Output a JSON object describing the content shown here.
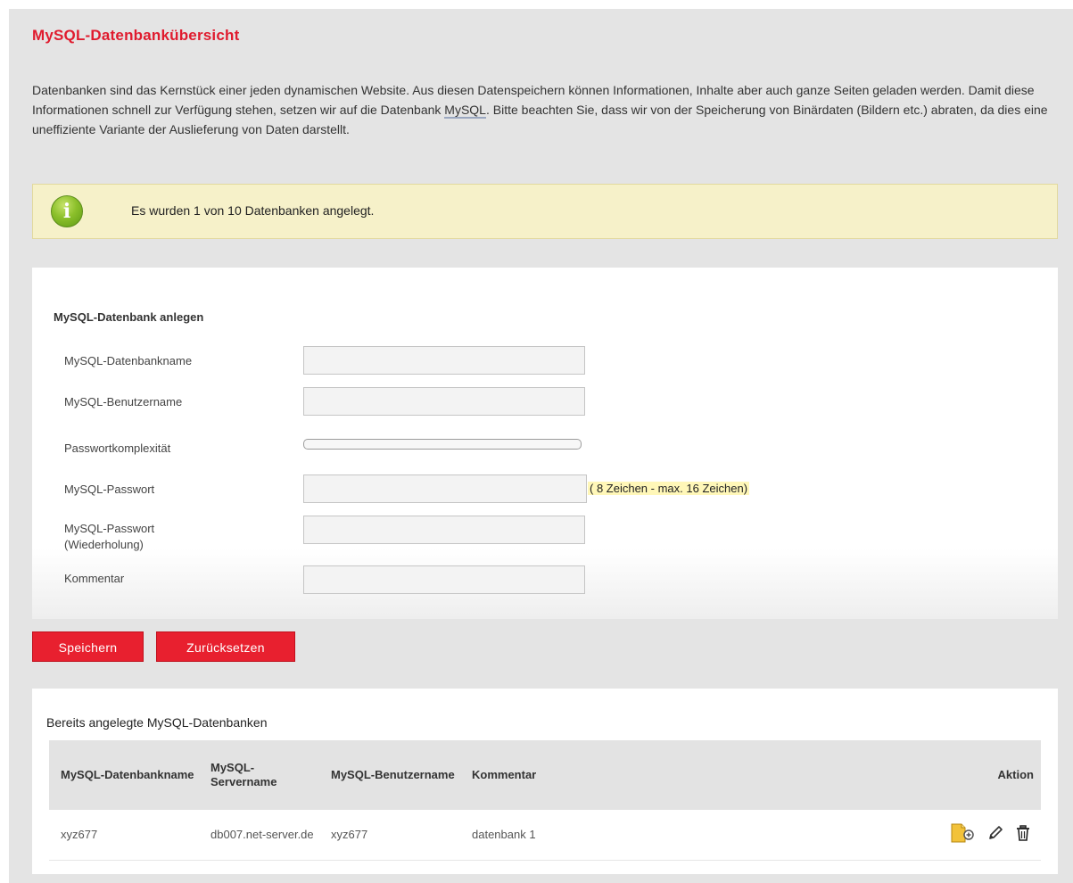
{
  "page": {
    "title": "MySQL-Datenbankübersicht",
    "intro_before": "Datenbanken sind das Kernstück einer jeden dynamischen Website. Aus diesen Datenspeichern können Informationen, Inhalte aber auch ganze Seiten geladen werden. Damit diese Informationen schnell zur Verfügung stehen, setzen wir auf die Datenbank ",
    "intro_abbr": "MySQL",
    "intro_after": ". Bitte beachten Sie, dass wir von der Speicherung von Binärdaten (Bildern etc.) abraten, da dies eine uneffiziente Variante der Auslieferung von Daten darstellt."
  },
  "notice": {
    "icon": "info-icon",
    "icon_glyph": "i",
    "text": "Es wurden 1 von 10 Datenbanken angelegt."
  },
  "form": {
    "heading": "MySQL-Datenbank anlegen",
    "db_name_label": "MySQL-Datenbankname",
    "db_name_value": "",
    "user_label": "MySQL-Benutzername",
    "user_value": "",
    "complexity_label": "Passwortkomplexität",
    "complexity_level": 0,
    "password_label": "MySQL-Passwort",
    "password_value": "",
    "password_hint": "( 8 Zeichen - max. 16 Zeichen)",
    "password_repeat_label": "MySQL-Passwort (Wiederholung)",
    "password_repeat_value": "",
    "comment_label": "Kommentar",
    "comment_value": "",
    "save_label": "Speichern",
    "reset_label": "Zurücksetzen"
  },
  "list": {
    "title": "Bereits angelegte MySQL-Datenbanken",
    "columns": {
      "db_name": "MySQL-Datenbankname",
      "server": "MySQL-Servername",
      "user": "MySQL-Benutzername",
      "comment": "Kommentar",
      "action": "Aktion"
    },
    "rows": [
      {
        "db_name": "xyz677",
        "server": "db007.net-server.de",
        "user": "xyz677",
        "comment": "datenbank 1",
        "actions": [
          "database-access-icon",
          "edit-pencil-icon",
          "trash-icon"
        ]
      }
    ]
  },
  "colors": {
    "accent": "#e01b2e",
    "button": "#e8202f",
    "notice_bg": "#f6f1c9",
    "hint_bg": "#fff7b8",
    "page_bg": "#e4e4e4"
  }
}
